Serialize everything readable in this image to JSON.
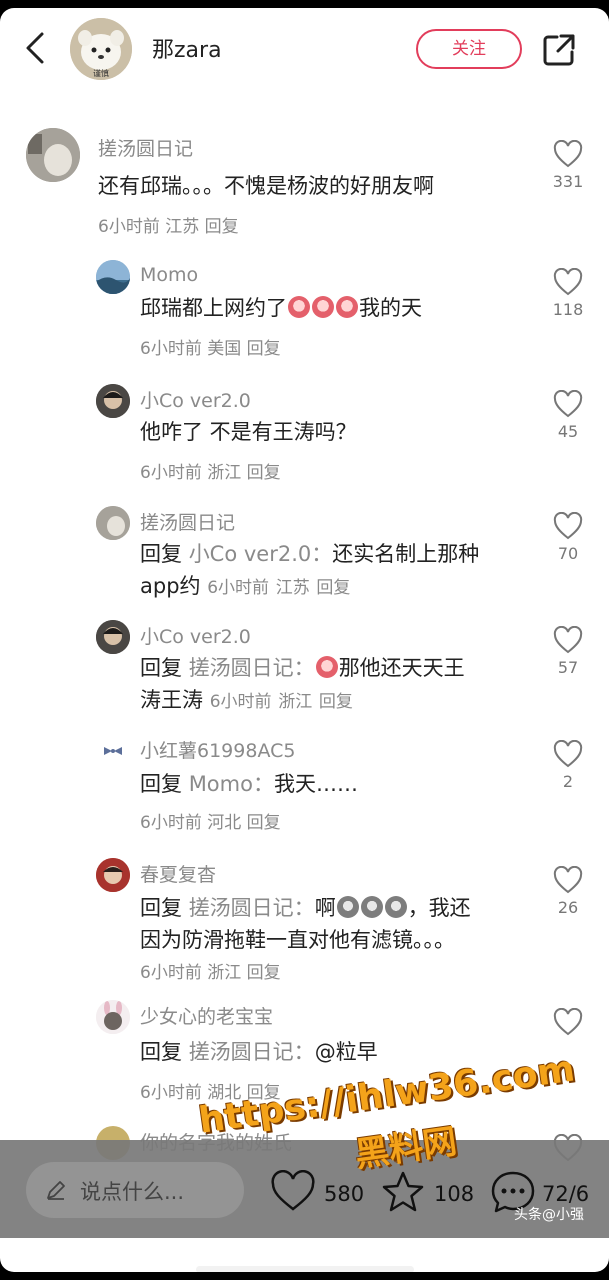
{
  "header": {
    "author_name": "那zara",
    "author_badge": "谨慎",
    "follow_label": "关注"
  },
  "comments": [
    {
      "user": "搓汤圆日记",
      "text": "还有邱瑞。。。不愧是杨波的好朋友啊",
      "time": "6小时前",
      "location": "江苏",
      "reply_label": "回复",
      "likes": "331"
    },
    {
      "user": "Momo",
      "text_before": "邱瑞都上网约了",
      "text_after": "我的天",
      "emoji": "crying-face",
      "time": "6小时前",
      "location": "美国",
      "reply_label": "回复",
      "likes": "118"
    },
    {
      "user": "小Co ver2.0",
      "text": "他咋了 不是有王涛吗？",
      "time": "6小时前",
      "location": "浙江",
      "reply_label": "回复",
      "likes": "45"
    },
    {
      "user": "搓汤圆日记",
      "reply_prefix": "回复",
      "reply_target": "小Co ver2.0：",
      "line1": "还实名制上那种",
      "line2": "app约",
      "time": "6小时前",
      "location": "江苏",
      "reply_label": "回复",
      "likes": "70"
    },
    {
      "user": "小Co ver2.0",
      "reply_prefix": "回复",
      "reply_target": "搓汤圆日记：",
      "line1": "那他还天天王",
      "line2": "涛王涛",
      "emoji": "scared-face",
      "time": "6小时前",
      "location": "浙江",
      "reply_label": "回复",
      "likes": "57"
    },
    {
      "user": "小红薯61998AC5",
      "reply_prefix": "回复",
      "reply_target": "Momo：",
      "line1": "我天……",
      "time": "6小时前",
      "location": "河北",
      "reply_label": "回复",
      "likes": "2"
    },
    {
      "user": "春夏复杳",
      "reply_prefix": "回复",
      "reply_target": "搓汤圆日记：",
      "line1_before": "啊",
      "line1_after": "，我还",
      "line2": "因为防滑拖鞋一直对他有滤镜。。。",
      "emoji": "gray-face",
      "time": "6小时前",
      "location": "浙江",
      "reply_label": "回复",
      "likes": "26"
    },
    {
      "user": "少女心的老宝宝",
      "reply_prefix": "回复",
      "reply_target": "搓汤圆日记：",
      "line1": "@粒早",
      "time": "6小时前",
      "location": "湖北",
      "reply_label": "回复",
      "likes": ""
    },
    {
      "user": "你的名字我的姓氏"
    }
  ],
  "bottom_bar": {
    "input_placeholder": "说点什么...",
    "like_count": "580",
    "star_count": "108",
    "comment_count": "72/6"
  },
  "credit": "头条@小强",
  "watermark": {
    "line1": "https://ihlw36.com",
    "line2": "黑料网"
  },
  "colors": {
    "accent": "#e23d5b",
    "meta_gray": "#8a8a8a",
    "watermark_orange": "#f4a31a"
  }
}
